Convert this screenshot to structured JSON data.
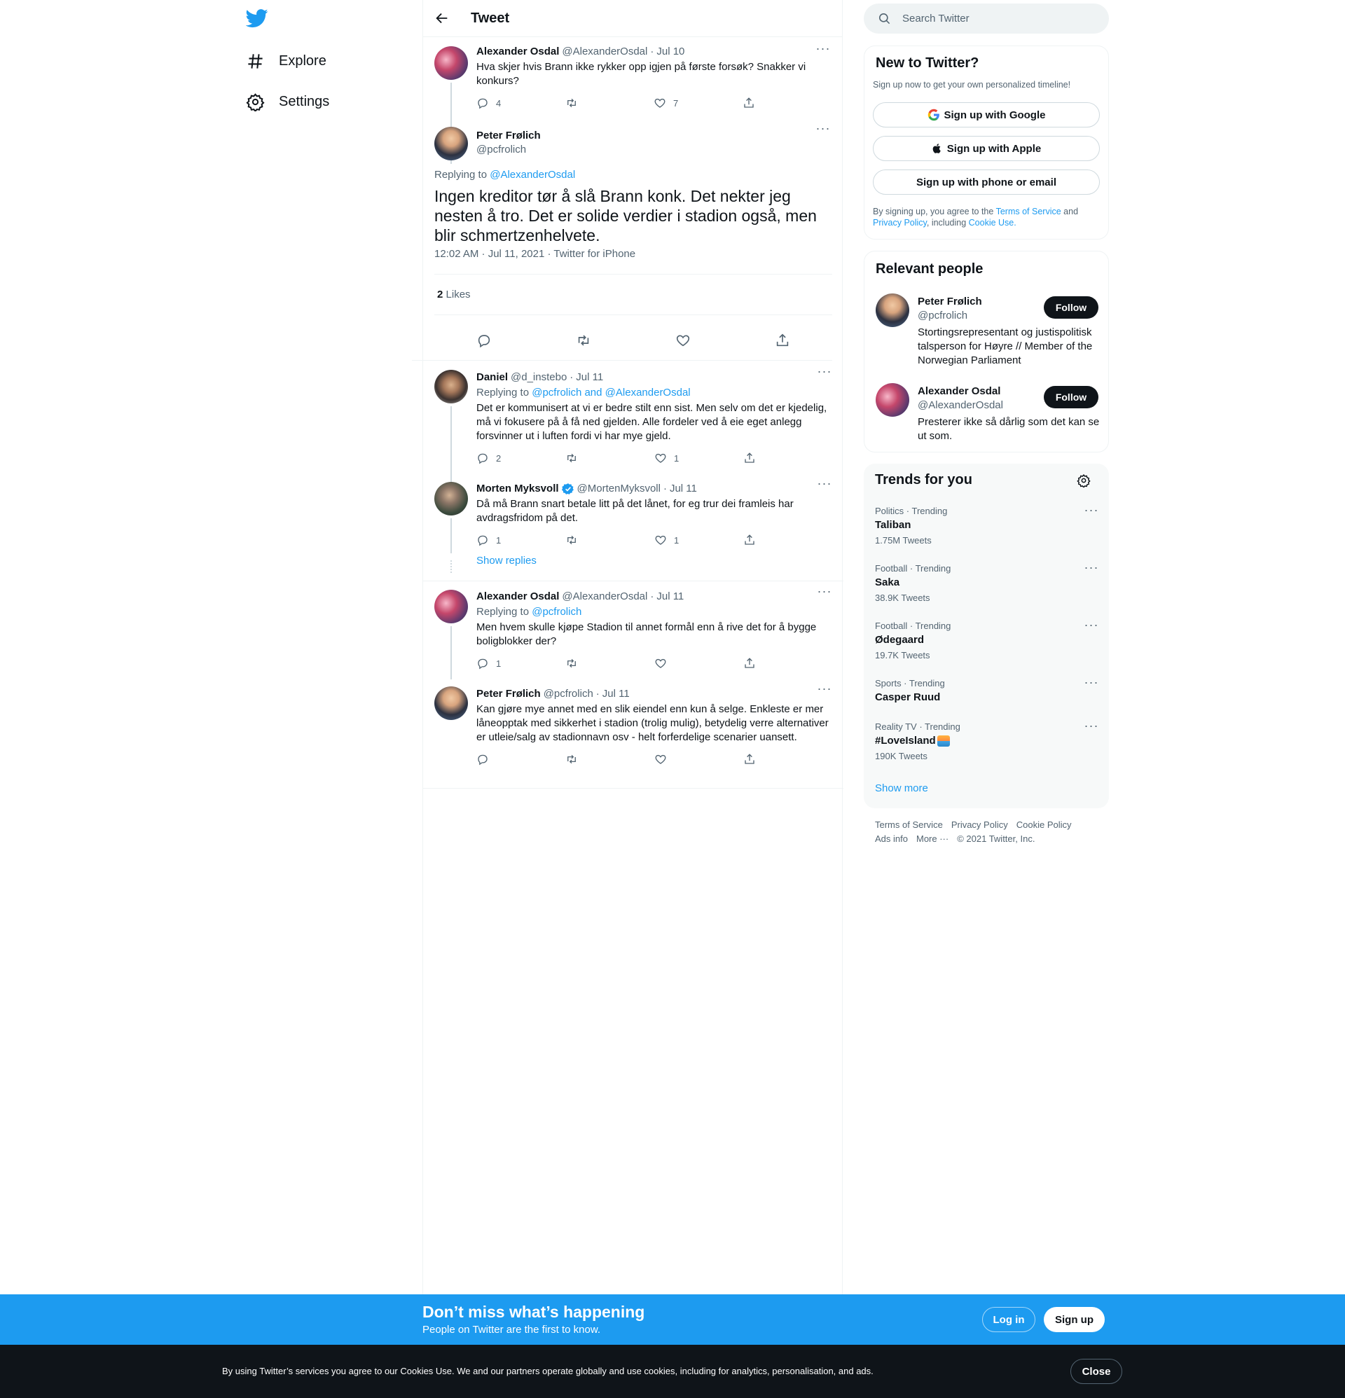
{
  "nav": {
    "explore": "Explore",
    "settings": "Settings"
  },
  "header": {
    "title": "Tweet"
  },
  "parent_tweet": {
    "name": "Alexander Osdal",
    "handle": "@AlexanderOsdal",
    "date": "Jul 10",
    "text": "Hva skjer hvis Brann ikke rykker opp igjen på første forsøk? Snakker vi konkurs?",
    "replies": "4",
    "retweets": "",
    "likes": "7"
  },
  "focal_tweet": {
    "name": "Peter Frølich",
    "handle": "@pcfrolich",
    "replying_prefix": "Replying to ",
    "replying_to": "@AlexanderOsdal",
    "text": "Ingen kreditor tør å slå Brann konk. Det nekter jeg nesten å tro. Det er solide verdier i stadion også, men blir schmertzenhelvete.",
    "timestamp": "12:02 AM · Jul 11, 2021 · Twitter for iPhone",
    "likes_count": "2",
    "likes_label": "Likes"
  },
  "replies": [
    {
      "name": "Daniel",
      "handle": "@d_instebo",
      "date": "Jul 11",
      "replying_prefix": "Replying to ",
      "replying_to": "@pcfrolich and @AlexanderOsdal",
      "text": "Det er kommunisert at vi er bedre stilt enn sist. Men selv om det er kjedelig, må vi fokusere på å få ned gjelden. Alle fordeler ved å eie eget anlegg forsvinner ut i luften fordi vi har mye gjeld.",
      "replies": "2",
      "likes": "1"
    },
    {
      "name": "Morten Myksvoll",
      "handle": "@MortenMyksvoll",
      "date": "Jul 11",
      "text": "Då må Brann snart betale litt på det lånet, for eg trur dei framleis har avdragsfridom på det.",
      "replies": "1",
      "likes": "1",
      "show_replies": "Show replies"
    },
    {
      "name": "Alexander Osdal",
      "handle": "@AlexanderOsdal",
      "date": "Jul 11",
      "replying_prefix": "Replying to ",
      "replying_to": "@pcfrolich",
      "text": "Men hvem skulle kjøpe Stadion til annet formål enn å rive det for å bygge boligblokker der?",
      "replies": "1"
    },
    {
      "name": "Peter Frølich",
      "handle": "@pcfrolich",
      "date": "Jul 11",
      "text": "Kan gjøre mye annet med en slik eiendel enn kun å selge. Enkleste er mer låneopptak med sikkerhet i stadion (trolig mulig), betydelig verre alternativer er utleie/salg av stadionnavn osv - helt forferdelige scenarier uansett."
    }
  ],
  "search": {
    "placeholder": "Search Twitter"
  },
  "new_to_twitter": {
    "title": "New to Twitter?",
    "subtitle": "Sign up now to get your own personalized timeline!",
    "google": "Sign up with Google",
    "apple": "Sign up with Apple",
    "email": "Sign up with phone or email",
    "legal_1": "By signing up, you agree to the ",
    "tos": "Terms of Service",
    "legal_2": " and ",
    "privacy": "Privacy Policy",
    "legal_3": ", including ",
    "cookie": "Cookie Use."
  },
  "relevant_people": {
    "title": "Relevant people",
    "people": [
      {
        "name": "Peter Frølich",
        "handle": "@pcfrolich",
        "bio": "Stortingsrepresentant og justispolitisk talsperson for Høyre // Member of the Norwegian Parliament",
        "follow": "Follow"
      },
      {
        "name": "Alexander Osdal",
        "handle": "@AlexanderOsdal",
        "bio": "Presterer ikke så dårlig som det kan se ut som.",
        "follow": "Follow"
      }
    ]
  },
  "trends": {
    "title": "Trends for you",
    "items": [
      {
        "category": "Politics · Trending",
        "name": "Taliban",
        "count": "1.75M Tweets"
      },
      {
        "category": "Football · Trending",
        "name": "Saka",
        "count": "38.9K Tweets"
      },
      {
        "category": "Football · Trending",
        "name": "Ødegaard",
        "count": "19.7K Tweets"
      },
      {
        "category": "Sports · Trending",
        "name": "Casper Ruud",
        "count": ""
      },
      {
        "category": "Reality TV · Trending",
        "name": "#LoveIsland",
        "count": "190K Tweets"
      }
    ],
    "show_more": "Show more"
  },
  "footer": {
    "terms": "Terms of Service",
    "privacy": "Privacy Policy",
    "cookie": "Cookie Policy",
    "ads": "Ads info",
    "more": "More ···",
    "copyright": "© 2021 Twitter, Inc."
  },
  "banner": {
    "title": "Don’t miss what’s happening",
    "subtitle": "People on Twitter are the first to know.",
    "login": "Log in",
    "signup": "Sign up"
  },
  "cookies": {
    "text": "By using Twitter’s services you agree to our Cookies Use. We and our partners operate globally and use cookies, including for analytics, personalisation, and ads.",
    "close": "Close"
  },
  "colors": {
    "brand": "#1d9bf0",
    "dark": "#0f1419",
    "muted": "#536471"
  },
  "icons": [
    "twitter-logo-icon",
    "hashtag-icon",
    "gear-icon",
    "back-arrow-icon",
    "reply-icon",
    "retweet-icon",
    "like-icon",
    "share-icon",
    "search-icon",
    "google-icon",
    "apple-icon",
    "verified-icon",
    "more-icon"
  ]
}
